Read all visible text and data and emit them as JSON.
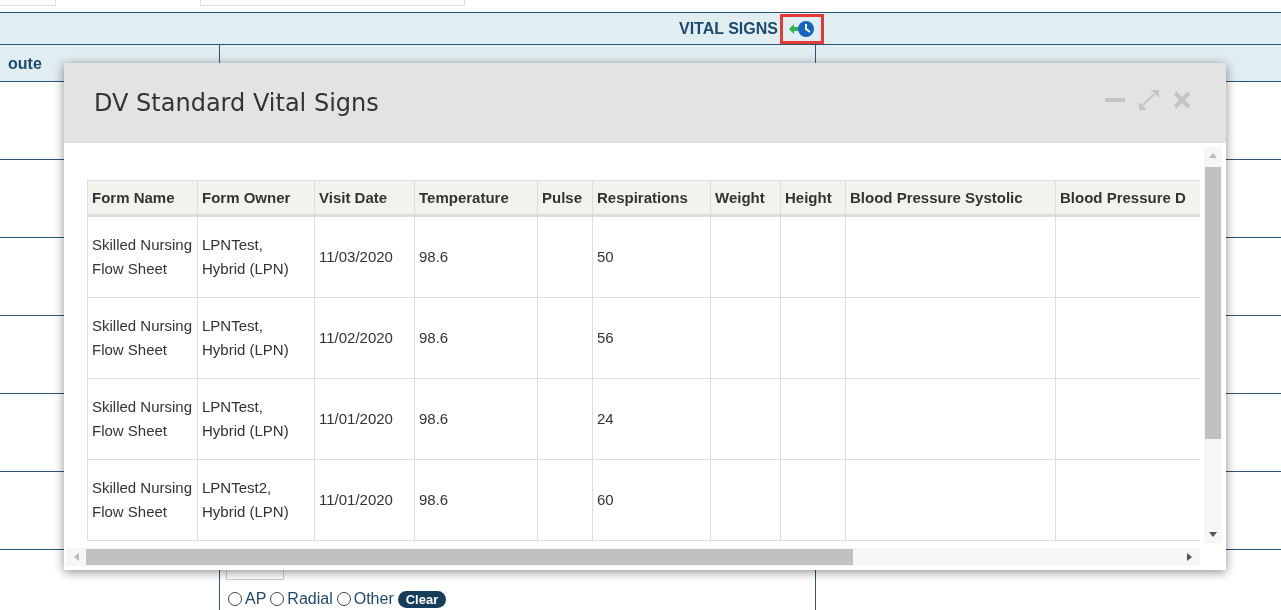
{
  "background": {
    "section_title": "VITAL SIGNS",
    "column_header": "oute",
    "radio_options": [
      {
        "label": "AP",
        "selected": false
      },
      {
        "label": "Radial",
        "selected": false
      },
      {
        "label": "Other",
        "selected": false
      }
    ],
    "clear_button": "Clear"
  },
  "dialog": {
    "title": "DV Standard Vital Signs",
    "columns": [
      "Form Name",
      "Form Owner",
      "Visit Date",
      "Temperature",
      "Pulse",
      "Respirations",
      "Weight",
      "Height",
      "Blood Pressure Systolic",
      "Blood Pressure D"
    ],
    "rows": [
      [
        "Skilled Nursing Flow Sheet",
        "LPNTest, Hybrid (LPN)",
        "11/03/2020",
        "98.6",
        "",
        "50",
        "",
        "",
        "",
        ""
      ],
      [
        "Skilled Nursing Flow Sheet",
        "LPNTest, Hybrid (LPN)",
        "11/02/2020",
        "98.6",
        "",
        "56",
        "",
        "",
        "",
        ""
      ],
      [
        "Skilled Nursing Flow Sheet",
        "LPNTest, Hybrid (LPN)",
        "11/01/2020",
        "98.6",
        "",
        "24",
        "",
        "",
        "",
        ""
      ],
      [
        "Skilled Nursing Flow Sheet",
        "LPNTest2, Hybrid (LPN)",
        "11/01/2020",
        "98.6",
        "",
        "60",
        "",
        "",
        "",
        ""
      ]
    ]
  }
}
